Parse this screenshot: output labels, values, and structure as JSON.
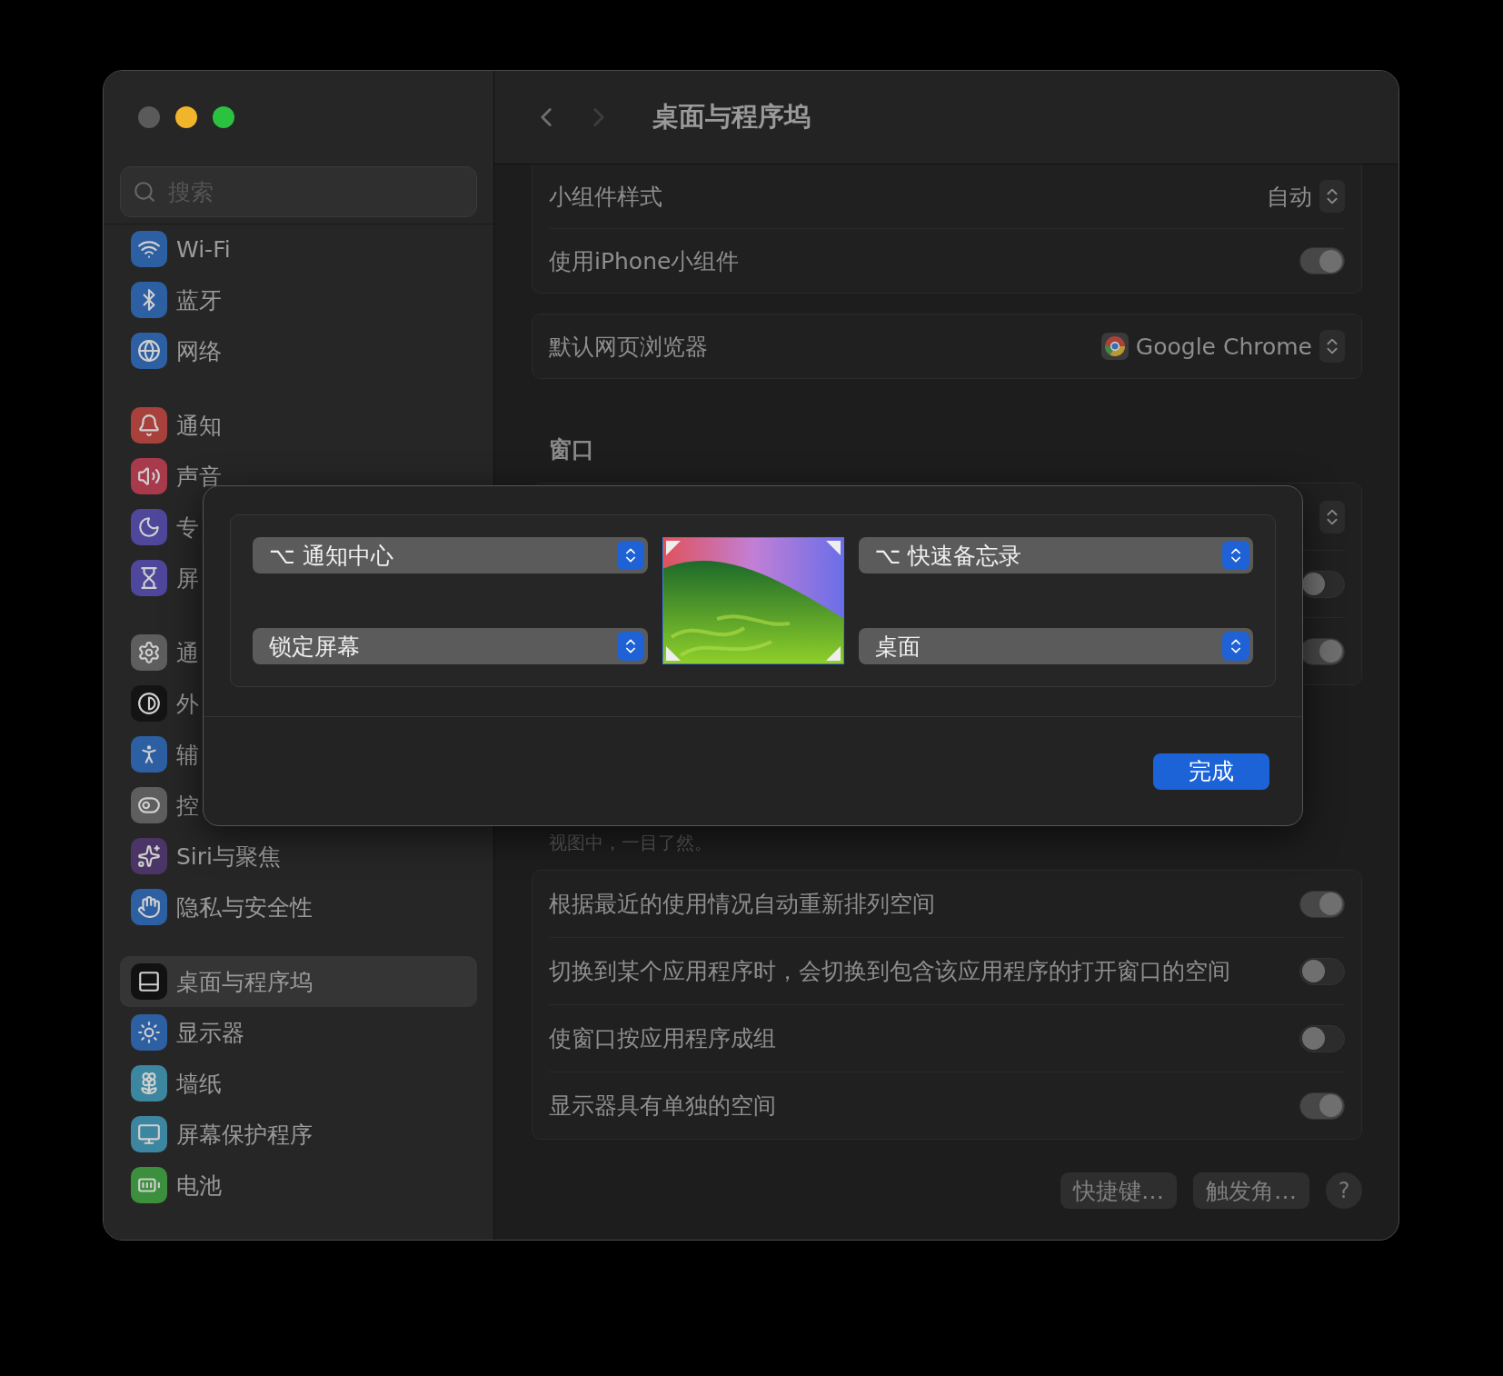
{
  "sidebar": {
    "search": {
      "placeholder": "搜索"
    },
    "groups": [
      {
        "items": [
          {
            "kind": "wifi",
            "label": "Wi-Fi",
            "color": "#2d5fa3",
            "selected": false
          },
          {
            "kind": "bluetooth",
            "label": "蓝牙",
            "color": "#2d5fa3",
            "selected": false
          },
          {
            "kind": "network",
            "label": "网络",
            "color": "#2d5fa3",
            "selected": false
          }
        ]
      },
      {
        "items": [
          {
            "kind": "notifications",
            "label": "通知",
            "color": "#a8413c",
            "selected": false
          },
          {
            "kind": "sound",
            "label": "声音",
            "color": "#a83a4c",
            "selected": false
          },
          {
            "kind": "focus",
            "label": "专",
            "color": "#4e479c",
            "selected": false
          },
          {
            "kind": "screen-time",
            "label": "屏",
            "color": "#4e479c",
            "selected": false
          }
        ]
      },
      {
        "items": [
          {
            "kind": "general",
            "label": "通",
            "color": "#5e5e5e",
            "selected": false
          },
          {
            "kind": "appearance",
            "label": "外",
            "color": "#141414",
            "selected": false
          },
          {
            "kind": "accessibility",
            "label": "辅",
            "color": "#2d5fa3",
            "selected": false
          },
          {
            "kind": "control-center",
            "label": "控",
            "color": "#5e5e5e",
            "selected": false
          },
          {
            "kind": "siri",
            "label": "Siri与聚焦",
            "color": "#4a3566",
            "selected": false
          },
          {
            "kind": "privacy",
            "label": "隐私与安全性",
            "color": "#2d5fa3",
            "selected": false
          }
        ]
      },
      {
        "items": [
          {
            "kind": "desktop",
            "label": "桌面与程序坞",
            "color": "#111111",
            "selected": true
          },
          {
            "kind": "displays",
            "label": "显示器",
            "color": "#2d5fa3",
            "selected": false
          },
          {
            "kind": "wallpaper",
            "label": "墙纸",
            "color": "#3d86a0",
            "selected": false
          },
          {
            "kind": "screensaver",
            "label": "屏幕保护程序",
            "color": "#3d86a0",
            "selected": false
          },
          {
            "kind": "battery",
            "label": "电池",
            "color": "#3b8f3d",
            "selected": false
          }
        ]
      }
    ]
  },
  "header": {
    "title": "桌面与程序坞"
  },
  "content": {
    "blocks": [
      {
        "kind": "card",
        "open_top": true,
        "rows": [
          {
            "kind": "select",
            "label": "小组件样式",
            "value": "自动"
          },
          {
            "kind": "toggle",
            "label": "使用iPhone小组件",
            "on": true
          }
        ]
      },
      {
        "kind": "card",
        "open_top": false,
        "rows": [
          {
            "kind": "app-select",
            "label": "默认网页浏览器",
            "value": "Google Chrome"
          }
        ]
      },
      {
        "kind": "heading",
        "text": "窗口"
      },
      {
        "kind": "card",
        "open_top": false,
        "rows": [
          {
            "kind": "select"
          },
          {
            "kind": "toggle",
            "on": false
          },
          {
            "kind": "toggle",
            "on": true
          }
        ]
      },
      {
        "kind": "caption",
        "text": "视图中，一目了然。"
      },
      {
        "kind": "card",
        "open_top": false,
        "rows": [
          {
            "kind": "toggle",
            "label": "根据最近的使用情况自动重新排列空间",
            "on": true
          },
          {
            "kind": "toggle",
            "label": "切换到某个应用程序时，会切换到包含该应用程序的打开窗口的空间",
            "on": false
          },
          {
            "kind": "toggle",
            "label": "使窗口按应用程序成组",
            "on": false
          },
          {
            "kind": "toggle",
            "label": "显示器具有单独的空间",
            "on": true
          }
        ]
      }
    ],
    "footer": {
      "buttons": [
        "快捷键…",
        "触发角…"
      ],
      "help": "?"
    }
  },
  "dialog": {
    "corners": [
      {
        "value": "⌥ 通知中心"
      },
      {
        "value": "⌥ 快速备忘录"
      },
      {
        "value": "锁定屏幕"
      },
      {
        "value": "桌面"
      }
    ],
    "done_button": "完成"
  }
}
